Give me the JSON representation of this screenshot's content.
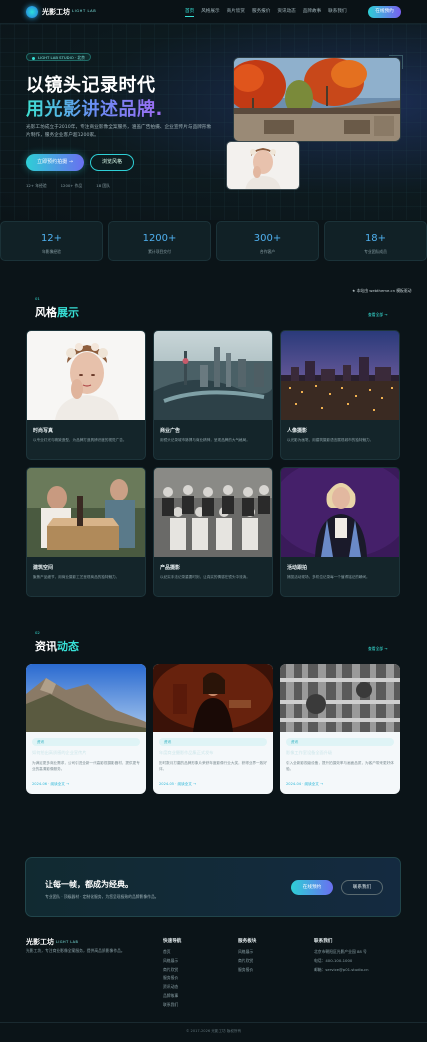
{
  "nav": {
    "logo": "光影工坊",
    "logo_sub": "LIGHT LAB",
    "links": [
      "首页",
      "风格展示",
      "商片欣赏",
      "服务报价",
      "资讯动态",
      "品牌故事",
      "联系我们"
    ],
    "cta": "在线预约"
  },
  "hero": {
    "badge": "LIGHT LAB STUDIO · 北京",
    "title_line1": "以镜头记录时代",
    "title_line2": "用光影讲述品牌.",
    "desc": "光影工坊成立于2010年，专注商业影像全案服务，涵盖广告拍摄、企业宣传片与品牌形象片制作，服务企业客户超1200家。",
    "btn_primary": "立即预约拍摄 →",
    "btn_secondary": "浏览风格",
    "stats": [
      "12+ 年经验",
      "1200+ 作品",
      "18 团队"
    ]
  },
  "stats": [
    {
      "num": "12+",
      "label": "年影像经验"
    },
    {
      "num": "1200+",
      "label": "累计项目交付"
    },
    {
      "num": "300+",
      "label": "合作客户"
    },
    {
      "num": "18+",
      "label": "专业团队成员"
    }
  ],
  "watermark": "★ 本站由 webtheme.cn 模板驱动",
  "styles_section": {
    "num": "01",
    "title_a": "风格",
    "title_b": "展示",
    "more": "查看全部 →",
    "cards": [
      {
        "title": "时尚写真",
        "desc": "以专业灯光与精致造型，为品牌打造具辨识度的视觉广告。"
      },
      {
        "title": "商业广告",
        "desc": "用镜头记录城市脉搏与商业精神，呈现品牌的大气格局。"
      },
      {
        "title": "人像摄影",
        "desc": "以光影为画笔，用建筑摄影语言展现城市的独特魅力。"
      },
      {
        "title": "建筑空间",
        "desc": "聚焦产品细节，用商业摄影工艺呈现商品的独特魅力。"
      },
      {
        "title": "产品摄影",
        "desc": "以纪实手法记录重要时刻，让真实的情感在镜头中流淌。"
      },
      {
        "title": "活动跟拍",
        "desc": "捕捉活动现场，多机位记录每一个值得铭记的瞬间。"
      }
    ]
  },
  "news_section": {
    "num": "02",
    "title_a": "资讯",
    "title_b": "动态",
    "more": "查看全部 →",
    "items": [
      {
        "tag": "资讯",
        "title": "如何拍出高质感的企业宣传片",
        "desc": "为满足更多商业需求，公司引进全新一代高影视摄影器材，提供更专业的高清影像服务。",
        "meta": "2024-06 · 阅读全文 →"
      },
      {
        "tag": "资讯",
        "title": "年度商业摄影作品集正式发布",
        "desc": "历时数月打磨的品牌形象片荣获年度影像行业大奖，获得业界一致好评。",
        "meta": "2024-05 · 阅读全文 →"
      },
      {
        "tag": "资讯",
        "title": "影像工作室设备全面升级",
        "desc": "引入全新影视级设备，提升拍摄效率与画面品质，为客户带来更好体验。",
        "meta": "2024-04 · 阅读全文 →"
      }
    ]
  },
  "cta": {
    "title": "让每一帧，都成为经典。",
    "desc": "专业团队 · 顶级器材 · 定制化服务，为您呈现极致的品牌影像作品。",
    "btn1": "在线预约",
    "btn2": "联系我们"
  },
  "footer": {
    "brand": "光影工坊",
    "brand_sub": "LIGHT LAB",
    "desc": "光影工坊，专注商业影像全案服务，提供高品质影像作品。",
    "col1_title": "快速导航",
    "col1": [
      "首页",
      "风格展示",
      "商片欣赏",
      "服务报价",
      "资讯动态",
      "品牌故事",
      "联系我们"
    ],
    "col2_title": "服务板块",
    "col2": [
      "风格展示",
      "商片欣赏",
      "服务报价"
    ],
    "col3_title": "联系我们",
    "col3": [
      "北京市朝阳区光影产业园 88 号",
      "电话：400-100-1000",
      "邮箱：service@p01.studio.cn"
    ],
    "copyright": "© 2017-2026 光影工坊 版权所有"
  }
}
